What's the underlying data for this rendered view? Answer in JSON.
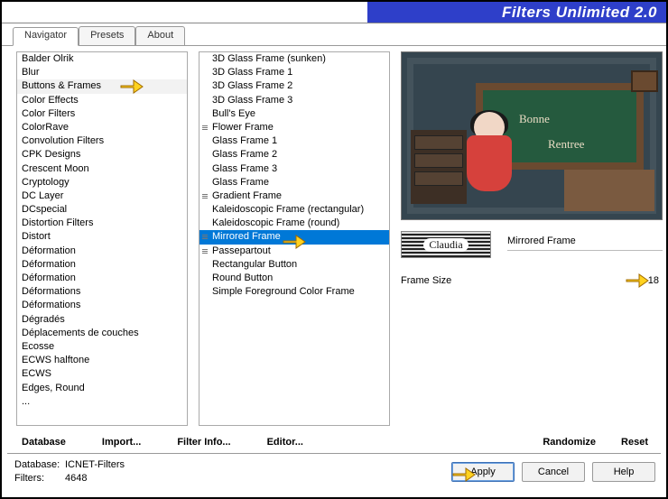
{
  "title": "Filters Unlimited 2.0",
  "tabs": [
    "Navigator",
    "Presets",
    "About"
  ],
  "categories": [
    "Balder Olrik",
    "Blur",
    "Buttons & Frames",
    "Color Effects",
    "Color Filters",
    "ColorRave",
    "Convolution Filters",
    "CPK Designs",
    "Crescent Moon",
    "Cryptology",
    "DC Layer",
    "DCspecial",
    "Distortion Filters",
    "Distort",
    "Déformation",
    "Déformation",
    "Déformation",
    "Déformations",
    "Déformations",
    "Dégradés",
    "Déplacements de couches",
    "Ecosse",
    "ECWS halftone",
    "ECWS",
    "Edges, Round",
    "..."
  ],
  "selected_category_index": 2,
  "filters": [
    {
      "label": "3D Glass Frame (sunken)",
      "ctl": false
    },
    {
      "label": "3D Glass Frame 1",
      "ctl": false
    },
    {
      "label": "3D Glass Frame 2",
      "ctl": false
    },
    {
      "label": "3D Glass Frame 3",
      "ctl": false
    },
    {
      "label": "Bull's Eye",
      "ctl": false
    },
    {
      "label": "Flower Frame",
      "ctl": true
    },
    {
      "label": "Glass Frame 1",
      "ctl": false
    },
    {
      "label": "Glass Frame 2",
      "ctl": false
    },
    {
      "label": "Glass Frame 3",
      "ctl": false
    },
    {
      "label": "Glass Frame",
      "ctl": false
    },
    {
      "label": "Gradient Frame",
      "ctl": true
    },
    {
      "label": "Kaleidoscopic Frame (rectangular)",
      "ctl": false
    },
    {
      "label": "Kaleidoscopic Frame (round)",
      "ctl": false
    },
    {
      "label": "Mirrored Frame",
      "ctl": true
    },
    {
      "label": "Passepartout",
      "ctl": true
    },
    {
      "label": "Rectangular Button",
      "ctl": false
    },
    {
      "label": "Round Button",
      "ctl": false
    },
    {
      "label": "Simple Foreground Color Frame",
      "ctl": false
    }
  ],
  "selected_filter_index": 13,
  "preview": {
    "chalk1": "Bonne",
    "chalk2": "Rentree",
    "stamp": "Claudia"
  },
  "current_filter_name": "Mirrored Frame",
  "param": {
    "label": "Frame Size",
    "value": "18"
  },
  "link_buttons": {
    "database": "Database",
    "import": "Import...",
    "filter_info": "Filter Info...",
    "editor": "Editor...",
    "randomize": "Randomize",
    "reset": "Reset"
  },
  "status": {
    "db_key": "Database:",
    "db_val": "ICNET-Filters",
    "filters_key": "Filters:",
    "filters_val": "4648"
  },
  "actions": {
    "apply": "Apply",
    "cancel": "Cancel",
    "help": "Help"
  }
}
